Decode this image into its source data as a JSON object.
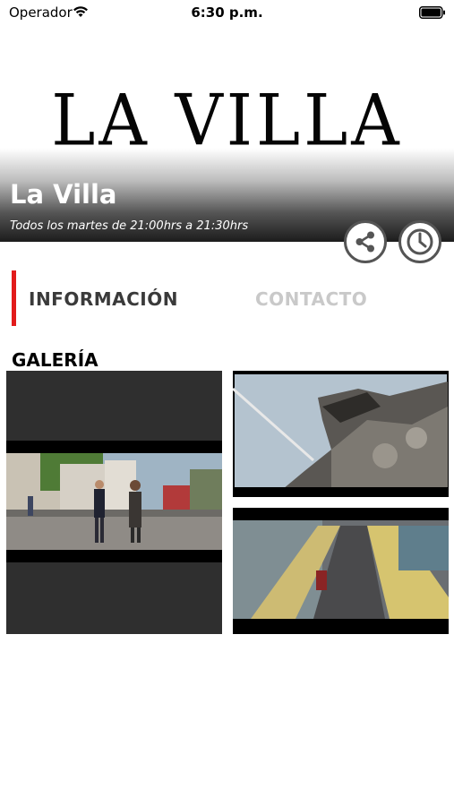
{
  "status_bar": {
    "carrier": "Operador",
    "time": "6:30 p.m."
  },
  "header": {
    "logo_text": "LA VILLA",
    "title": "La Villa",
    "schedule": "Todos los martes de 21:00hrs a 21:30hrs"
  },
  "actions": {
    "share_icon": "share-icon",
    "schedule_icon": "clock-icon"
  },
  "tabs": [
    {
      "label": "INFORMACIÓN",
      "active": true
    },
    {
      "label": "CONTACTO",
      "active": false
    }
  ],
  "gallery": {
    "title": "GALERÍA",
    "images": [
      "street-scene-with-two-presenters",
      "stone-statue-closeup",
      "aerial-view-of-street"
    ]
  },
  "colors": {
    "accent": "#e21b1b",
    "tab_inactive": "#c9c9c9",
    "tab_active": "#3a3a3a"
  }
}
